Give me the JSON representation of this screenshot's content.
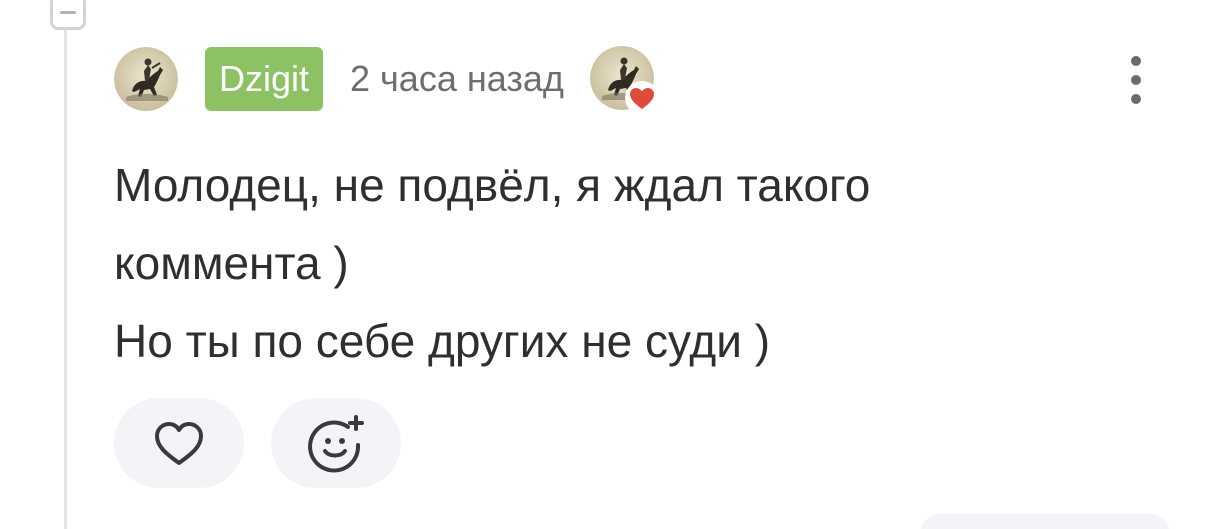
{
  "comment": {
    "author": "Dzigit",
    "time": "2 часа назад",
    "text_lines": [
      "Молодец, не подвёл, я ждал такого",
      "коммента )",
      "Но ты по себе других не суди )"
    ]
  },
  "colors": {
    "author_badge": "#8dc264",
    "reaction_heart": "#e04a3a",
    "text": "#2f2f2f",
    "muted": "#6e6e6e",
    "action_bg": "#f3f4f7"
  },
  "icons": {
    "collapse": "minus-icon",
    "more": "more-vertical-icon",
    "like": "heart-outline-icon",
    "react": "emoji-add-icon",
    "reaction": "heart-icon"
  }
}
